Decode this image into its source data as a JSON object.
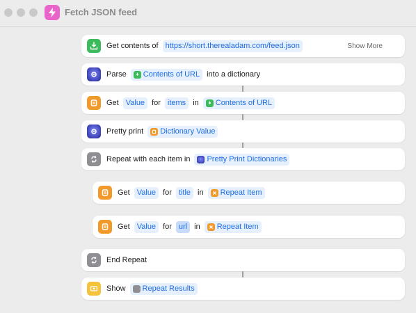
{
  "window": {
    "title": "Fetch JSON feed"
  },
  "actions": [
    {
      "label": "Get contents of",
      "url": "https://short.therealadam.com/feed.json",
      "show_more": "Show More"
    },
    {
      "label": "Parse",
      "var": "Contents of URL",
      "tail": "into a dictionary"
    },
    {
      "label": "Get",
      "t1": "Value",
      "w1": "for",
      "t2": "items",
      "w2": "in",
      "var": "Contents of URL"
    },
    {
      "label": "Pretty print",
      "var": "Dictionary Value"
    },
    {
      "label": "Repeat with each item in",
      "var": "Pretty Print Dictionaries"
    },
    {
      "label": "Get",
      "t1": "Value",
      "w1": "for",
      "t2": "title",
      "w2": "in",
      "var": "Repeat Item"
    },
    {
      "label": "Get",
      "t1": "Value",
      "w1": "for",
      "t2": "url",
      "w2": "in",
      "var": "Repeat Item"
    },
    {
      "label": "End Repeat"
    },
    {
      "label": "Show",
      "var": "Repeat Results"
    }
  ],
  "colors": {
    "token_text": "#1e6ee6",
    "token_bg": "#e6effc",
    "app_icon": "#e865c9",
    "icon_green": "#3dbb5c",
    "icon_orange": "#f19a2b",
    "icon_gray": "#8e8e93",
    "icon_yellow": "#f4c23b"
  }
}
